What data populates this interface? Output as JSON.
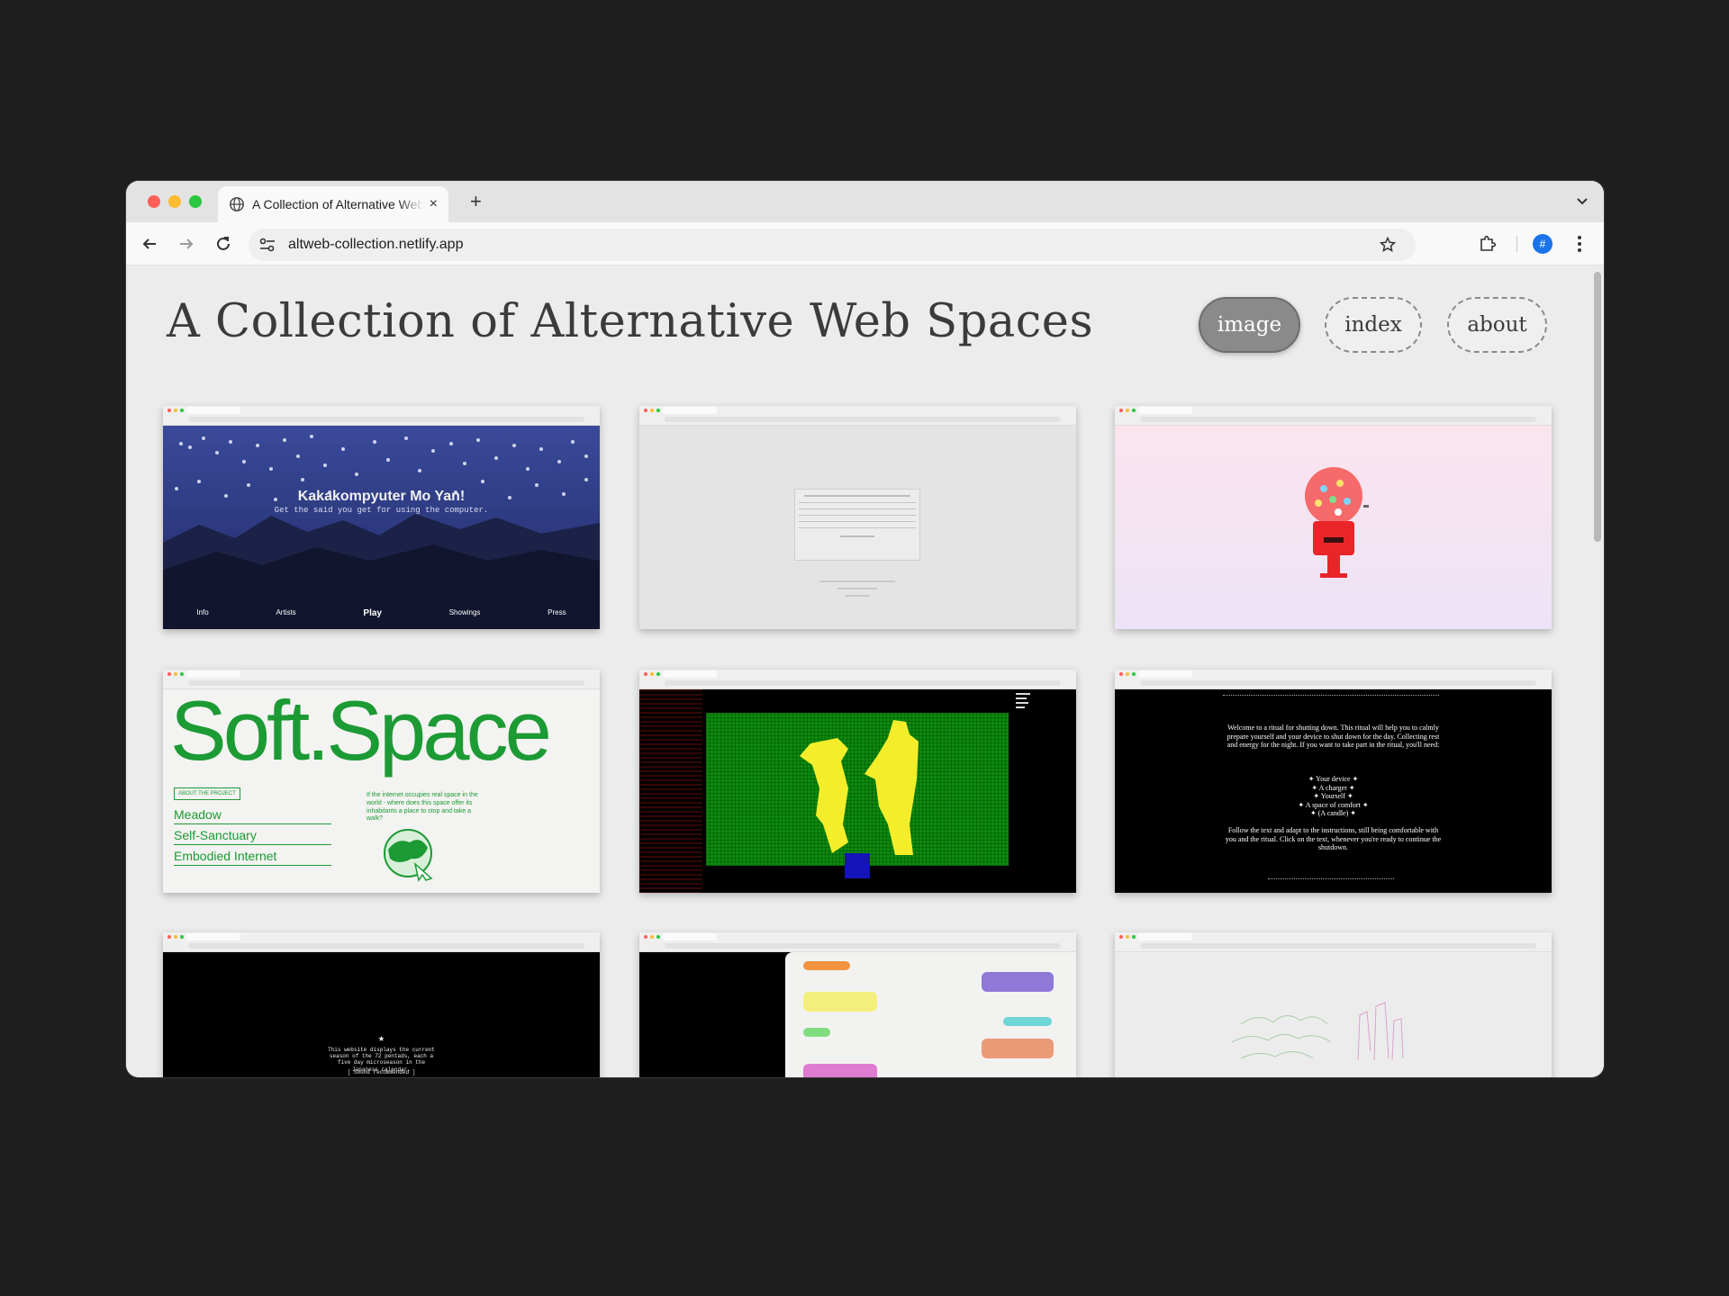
{
  "browser": {
    "tab_title": "A Collection of Alternative Web Spaces",
    "tab_close": "×",
    "new_tab": "+",
    "url": "altweb-collection.netlify.app",
    "avatar_letter": "#"
  },
  "page": {
    "title": "A Collection of Alternative Web Spaces",
    "nav": [
      {
        "label": "image",
        "active": true
      },
      {
        "label": "index",
        "active": false
      },
      {
        "label": "about",
        "active": false
      }
    ]
  },
  "cards": {
    "kakakompyuter": {
      "title": "Kakakompyuter Mo Yan!",
      "subtitle": "Get the said you get for using the computer.",
      "nav": [
        "Info",
        "Artists",
        "Play",
        "Showings",
        "Press"
      ]
    },
    "softspace": {
      "title": "Soft.Space",
      "about": "ABOUT THE PROJECT",
      "items": [
        "Meadow",
        "Self-Sanctuary",
        "Embodied Internet"
      ],
      "blurb": "If the internet occupies real space in the world - where does this space offer its inhabitants a place to stop and take a walk?"
    },
    "ritual": {
      "intro": "Welcome to a ritual for shutting down. This ritual will help you to calmly prepare yourself and your device to shut down for the day. Collecting rest and energy for the night. If you want to take part in the ritual, you'll need:",
      "list": [
        "✦ Your device ✦",
        "✦ A charger ✦",
        "✦ Yourself ✦",
        "✦ A space of comfort ✦",
        "✦ (A candle) ✦"
      ],
      "outro": "Follow the text and adapt to the instructions, still being comfortable with you and the ritual. Click on the text, whenever you're ready to continue the shutdown."
    },
    "season": {
      "text": "This website displays the current season of the 72 pentads, each a five day microseason in the Japanese calendar.",
      "sound": "[ Sound recommended ]"
    }
  },
  "colors": {
    "accent_green": "#1c9a34",
    "pill_active": "#8a8a8a",
    "pixel_green": "#0c8a0c",
    "pixel_yellow": "#f4ee2a"
  }
}
